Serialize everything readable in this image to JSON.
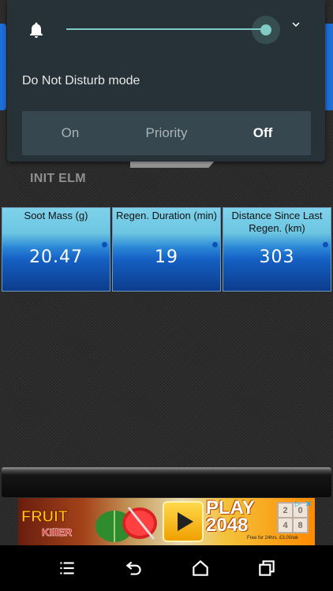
{
  "background": {
    "init_label": "INIT ELM"
  },
  "notification_panel": {
    "volume_icon": "bell-icon",
    "volume_level": 1.0,
    "expand_icon": "chevron-down-icon",
    "dnd_title": "Do Not Disturb mode",
    "dnd_options": [
      "On",
      "Priority",
      "Off"
    ],
    "dnd_selected": "Off"
  },
  "gauges": [
    {
      "label": "Soot Mass (g)",
      "value": "20.47"
    },
    {
      "label": "Regen. Duration (min)",
      "value": "19"
    },
    {
      "label": "Distance Since Last Regen. (km)",
      "value": "303"
    }
  ],
  "ad": {
    "game1": "FRUIT",
    "game1_sub": "KIllER",
    "cta": "PLAY",
    "game2": "2048",
    "tiles": [
      "2",
      "0",
      "4",
      "8"
    ],
    "fine_print": "Free for 24hrs. £3.00/wk",
    "close_icon": "close-icon",
    "adchoices_icon": "ad-choices-icon"
  },
  "navbar": {
    "menu_icon": "menu-icon",
    "back_icon": "back-icon",
    "home_icon": "home-icon",
    "recents_icon": "recents-icon"
  },
  "colors": {
    "panel_bg": "#263238",
    "accent": "#80cbc4",
    "gauge_top": "#7fd2ea",
    "gauge_bottom": "#0c3c8c"
  }
}
